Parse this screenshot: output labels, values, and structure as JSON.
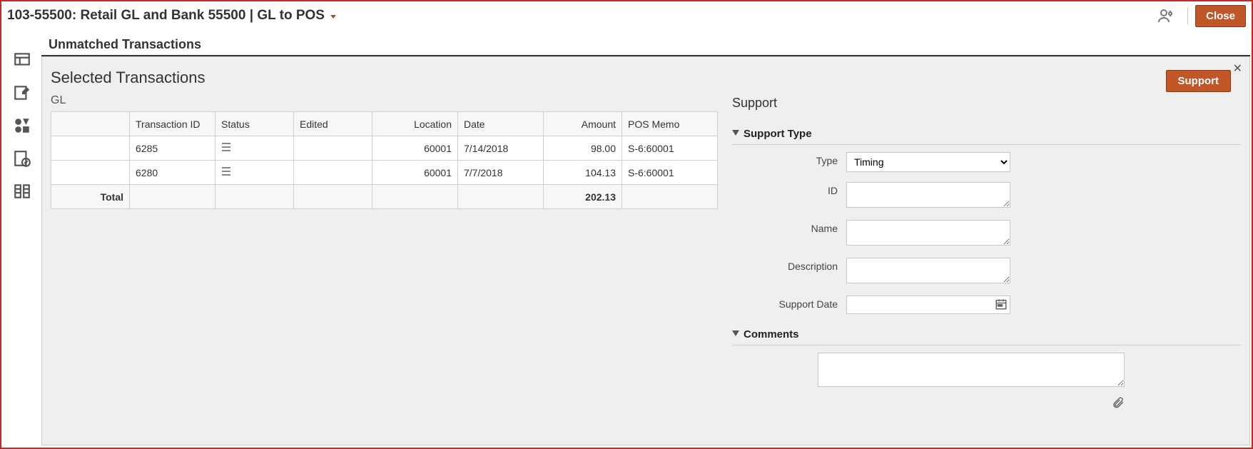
{
  "header": {
    "title": "103-55500: Retail GL and Bank 55500 | GL to POS",
    "close": "Close"
  },
  "content": {
    "heading": "Unmatched Transactions"
  },
  "panel": {
    "title": "Selected Transactions",
    "support_button": "Support",
    "gl_label": "GL",
    "table": {
      "columns": [
        "",
        "Transaction ID",
        "Status",
        "Edited",
        "Location",
        "Date",
        "Amount",
        "POS Memo"
      ],
      "rows": [
        {
          "txid": "6285",
          "status": "icon",
          "edited": "",
          "location": "60001",
          "date": "7/14/2018",
          "amount": "98.00",
          "memo": "S-6:60001"
        },
        {
          "txid": "6280",
          "status": "icon",
          "edited": "",
          "location": "60001",
          "date": "7/7/2018",
          "amount": "104.13",
          "memo": "S-6:60001"
        }
      ],
      "total_label": "Total",
      "total_amount": "202.13"
    }
  },
  "support": {
    "heading": "Support",
    "section_type": "Support Type",
    "type_label": "Type",
    "type_value": "Timing",
    "id_label": "ID",
    "id_value": "",
    "name_label": "Name",
    "name_value": "",
    "desc_label": "Description",
    "desc_value": "",
    "date_label": "Support Date",
    "date_value": "",
    "section_comments": "Comments",
    "comments_value": ""
  }
}
